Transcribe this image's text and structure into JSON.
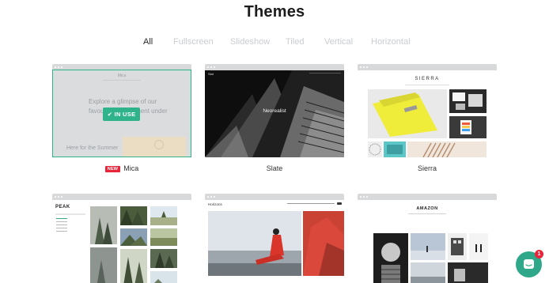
{
  "page": {
    "title": "Themes"
  },
  "filters": [
    {
      "label": "All",
      "active": true
    },
    {
      "label": "Fullscreen",
      "active": false
    },
    {
      "label": "Slideshow",
      "active": false
    },
    {
      "label": "Tiled",
      "active": false
    },
    {
      "label": "Vertical",
      "active": false
    },
    {
      "label": "Horizontal",
      "active": false
    }
  ],
  "themes": [
    {
      "name": "Mica",
      "badge": "NEW",
      "in_use": true,
      "in_use_label": "IN USE",
      "preview": {
        "logo": "Mica",
        "headline": "Explore a glimpse of our favourite environment under",
        "tagline": "Here for the Summer"
      }
    },
    {
      "name": "Slate",
      "preview": {
        "logo": "Slat",
        "headline": "Neorealist"
      }
    },
    {
      "name": "Sierra",
      "preview": {
        "logo": "SIERRA"
      }
    },
    {
      "name": "",
      "preview": {
        "logo": "PEAK"
      }
    },
    {
      "name": "",
      "preview": {
        "logo": "Horizons"
      }
    },
    {
      "name": "",
      "preview": {
        "logo": "AMAZON"
      }
    }
  ],
  "chat": {
    "unread_count": "1"
  },
  "colors": {
    "accent": "#2fb38a",
    "badge_red": "#e8253a",
    "chat_button": "#2fa889",
    "filter_inactive": "#c9ccd1"
  },
  "icons": {
    "check": "check-icon",
    "chat": "chat-icon"
  }
}
